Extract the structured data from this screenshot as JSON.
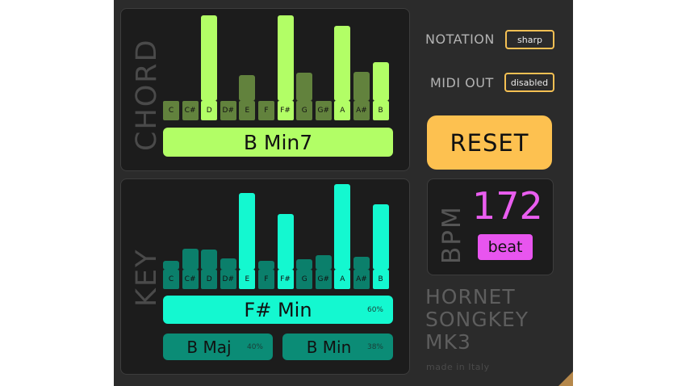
{
  "notes": [
    "C",
    "C#",
    "D",
    "D#",
    "E",
    "F",
    "F#",
    "G",
    "G#",
    "A",
    "A#",
    "B"
  ],
  "chord": {
    "label": "CHORD",
    "levels": [
      0,
      0,
      1.0,
      0,
      0.3,
      0,
      1.0,
      0.33,
      0,
      0.88,
      0.34,
      0.45
    ],
    "highlighted": [
      false,
      false,
      true,
      false,
      false,
      false,
      true,
      false,
      false,
      true,
      false,
      true
    ],
    "result": "B Min7",
    "colors": {
      "active": "#b2fe66",
      "dim": "#62823d"
    }
  },
  "key": {
    "label": "KEY",
    "levels": [
      0.1,
      0.25,
      0.24,
      0.13,
      0.9,
      0.1,
      0.65,
      0.12,
      0.17,
      1.0,
      0.15,
      0.76
    ],
    "highlighted": [
      false,
      false,
      false,
      false,
      true,
      false,
      true,
      false,
      false,
      true,
      false,
      true
    ],
    "result": "F# Min",
    "result_pct": "60%",
    "alternatives": [
      {
        "name": "B Maj",
        "pct": "40%"
      },
      {
        "name": "B Min",
        "pct": "38%"
      }
    ],
    "colors": {
      "active": "#14f8d0",
      "dim": "#0b7f6b"
    }
  },
  "settings": {
    "notation_label": "NOTATION",
    "notation_value": "sharp",
    "midi_label": "MIDI OUT",
    "midi_value": "disabled"
  },
  "reset_label": "RESET",
  "bpm": {
    "label": "BPM",
    "value": "172",
    "beat_label": "beat"
  },
  "brand": {
    "line1": "HORNET",
    "line2": "SONGKEY",
    "line3": "MK3",
    "made_in": "made in Italy"
  }
}
